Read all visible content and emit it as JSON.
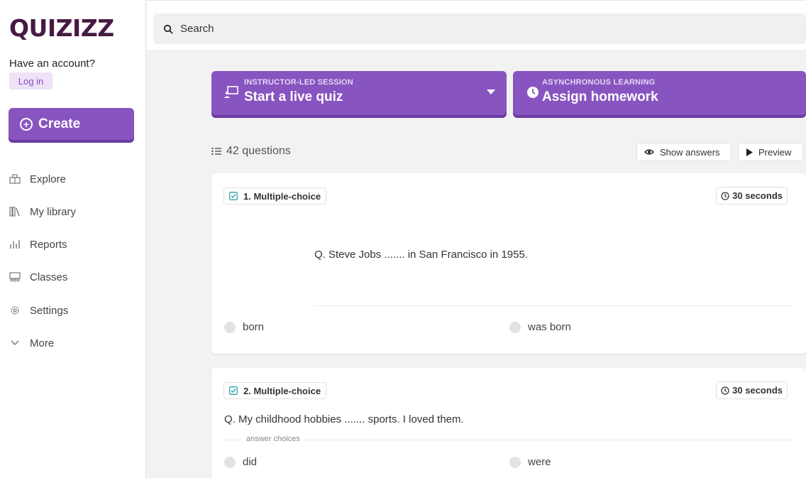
{
  "brand": {
    "logo_text": "QUIZIZZ",
    "accent": "#8854c0",
    "logo_color": "#461a42"
  },
  "sidebar": {
    "have_account": "Have an account?",
    "login_label": "Log in",
    "create_label": "Create",
    "nav": [
      {
        "label": "Explore",
        "icon": "explore-icon"
      },
      {
        "label": "My library",
        "icon": "library-icon"
      },
      {
        "label": "Reports",
        "icon": "reports-icon"
      },
      {
        "label": "Classes",
        "icon": "classes-icon"
      },
      {
        "label": "Settings",
        "icon": "settings-icon"
      },
      {
        "label": "More",
        "icon": "chevron-down-icon"
      }
    ]
  },
  "search": {
    "placeholder": "Search"
  },
  "sessions": {
    "live": {
      "kicker": "INSTRUCTOR-LED SESSION",
      "title": "Start a live quiz"
    },
    "homework": {
      "kicker": "ASYNCHRONOUS LEARNING",
      "title": "Assign homework"
    }
  },
  "questions": {
    "count_label": "42 questions",
    "show_answers_label": "Show answers",
    "preview_label": "Preview",
    "items": [
      {
        "type_label": "1. Multiple-choice",
        "time_label": "30 seconds",
        "text": "Q. Steve Jobs ....... in San Francisco in 1955.",
        "choices": [
          "born",
          "was born"
        ]
      },
      {
        "type_label": "2. Multiple-choice",
        "time_label": "30 seconds",
        "text": "Q. My childhood hobbies ....... sports. I loved them.",
        "answer_choices_label": "answer choices",
        "choices": [
          "did",
          "were"
        ]
      }
    ]
  }
}
